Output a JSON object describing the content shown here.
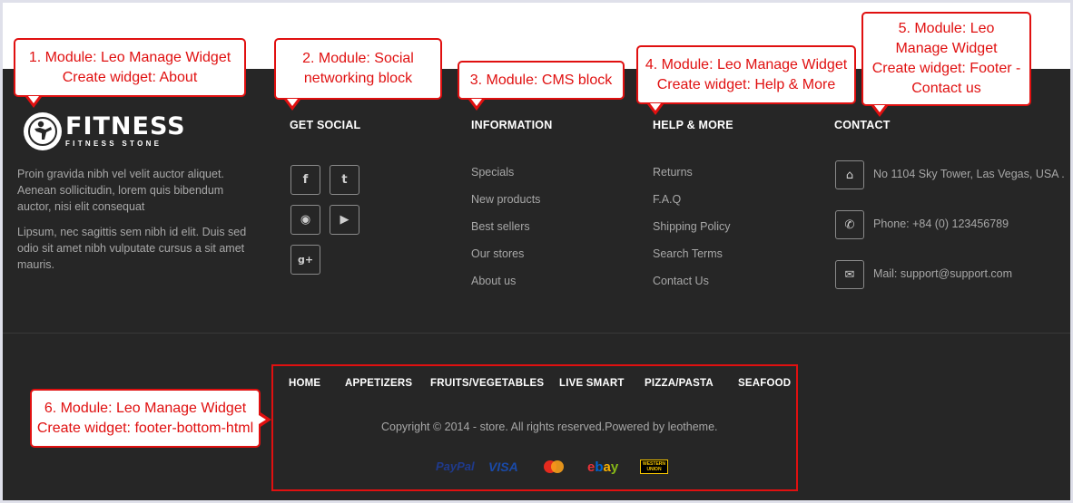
{
  "logo": {
    "main": "FITNESS",
    "sub": "FITNESS STONE",
    "icon": "athlete-logo-icon"
  },
  "about": {
    "p1": "Proin gravida nibh vel velit auctor aliquet. Aenean sollicitudin, lorem quis bibendum auctor, nisi elit consequat",
    "p2": "Lipsum, nec sagittis sem nibh id elit. Duis sed odio sit amet nibh vulputate cursus a sit amet mauris."
  },
  "social": {
    "title": "GET SOCIAL",
    "items": [
      {
        "icon": "facebook-icon",
        "glyph": "f"
      },
      {
        "icon": "twitter-icon",
        "glyph": "t"
      },
      {
        "icon": "rss-icon",
        "glyph": "◉"
      },
      {
        "icon": "youtube-icon",
        "glyph": "▶"
      },
      {
        "icon": "google-plus-icon",
        "glyph": "g+"
      }
    ]
  },
  "information": {
    "title": "INFORMATION",
    "links": [
      "Specials",
      "New products",
      "Best sellers",
      "Our stores",
      "About us"
    ]
  },
  "help": {
    "title": "HELP & MORE",
    "links": [
      "Returns",
      "F.A.Q",
      "Shipping Policy",
      "Search Terms",
      "Contact Us"
    ]
  },
  "contact": {
    "title": "CONTACT",
    "items": [
      {
        "icon": "home-icon",
        "glyph": "⌂",
        "text": "No 1104 Sky Tower, Las Vegas, USA ."
      },
      {
        "icon": "phone-icon",
        "glyph": "✆",
        "text": "Phone: +84 (0) 123456789"
      },
      {
        "icon": "mail-icon",
        "glyph": "✉",
        "text": "Mail: support@support.com"
      }
    ]
  },
  "bottom_nav": [
    "HOME",
    "APPETIZERS",
    "FRUITS/VEGETABLES",
    "LIVE SMART",
    "PIZZA/PASTA",
    "SEAFOOD"
  ],
  "copyright": "Copyright © 2014 - store. All rights reserved.Powered by leotheme.",
  "payments": [
    {
      "name": "PayPal",
      "color": "#1f3a8c"
    },
    {
      "name": "VISA",
      "color": "#1a4aa8"
    },
    {
      "name": "mastercard",
      "color": "#e8511a"
    },
    {
      "name": "ebay",
      "color": "#e53238"
    },
    {
      "name": "WESTERN UNION",
      "color": "#f6c500"
    }
  ],
  "annotations": {
    "a1": "1. Module: Leo Manage Widget\nCreate widget: About",
    "a2": "2. Module: Social\nnetworking block",
    "a3": "3. Module: CMS block",
    "a4": "4. Module: Leo Manage Widget\nCreate widget: Help & More",
    "a5": "5. Module: Leo\nManage Widget\nCreate widget: Footer -\nContact us",
    "a6": "6. Module: Leo Manage Widget\nCreate widget: footer-bottom-html"
  },
  "colors": {
    "footer_bg": "#262626",
    "annotation_red": "#e01010"
  }
}
